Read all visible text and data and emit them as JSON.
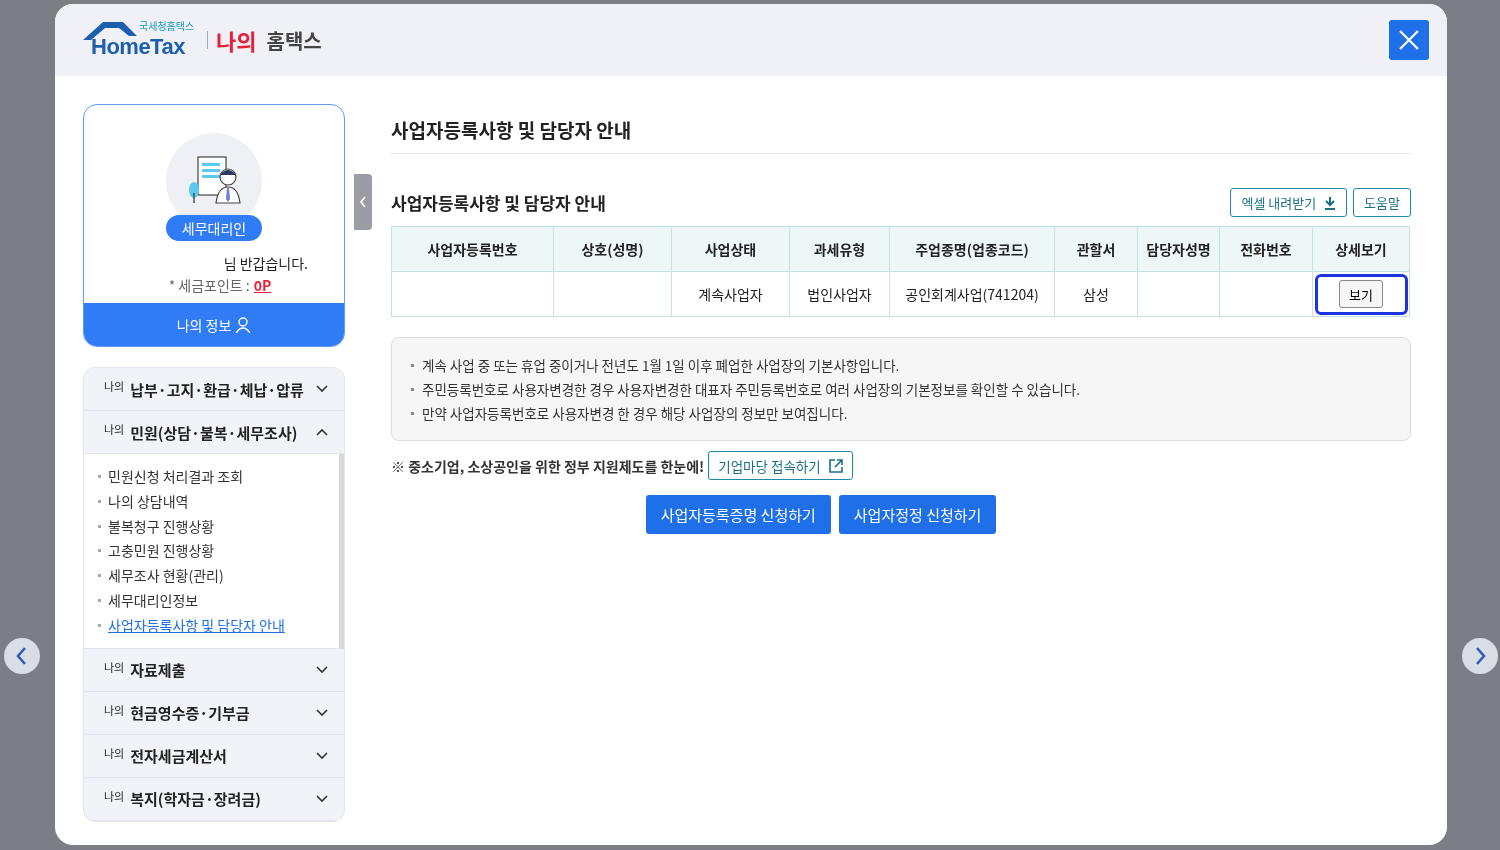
{
  "header": {
    "logo_subtitle": "국세청홈택스",
    "logo_text": "HomeTax",
    "title_highlight": "나의",
    "title": "홈택스"
  },
  "profile": {
    "badge": "세무대리인",
    "greeting": "님 반갑습니다.",
    "points_label": "* 세금포인트 :",
    "points_value": "0P",
    "my_info_button": "나의 정보"
  },
  "menu": [
    {
      "prefix": "나의",
      "label": "납부·고지·환급·체납·압류",
      "expanded": false
    },
    {
      "prefix": "나의",
      "label": "민원(상담·불복·세무조사)",
      "expanded": true,
      "children": [
        {
          "label": "민원신청 처리결과 조회",
          "selected": false
        },
        {
          "label": "나의 상담내역",
          "selected": false
        },
        {
          "label": "불복청구 진행상황",
          "selected": false
        },
        {
          "label": "고충민원 진행상황",
          "selected": false
        },
        {
          "label": "세무조사 현황(관리)",
          "selected": false
        },
        {
          "label": "세무대리인정보",
          "selected": false
        },
        {
          "label": "사업자등록사항 및 담당자 안내",
          "selected": true
        }
      ]
    },
    {
      "prefix": "나의",
      "label": "자료제출",
      "expanded": false
    },
    {
      "prefix": "나의",
      "label": "현금영수증·기부금",
      "expanded": false
    },
    {
      "prefix": "나의",
      "label": "전자세금계산서",
      "expanded": false
    },
    {
      "prefix": "나의",
      "label": "복지(학자금·장려금)",
      "expanded": false
    }
  ],
  "page_title": "사업자등록사항 및 담당자 안내",
  "section_title": "사업자등록사항 및 담당자 안내",
  "excel_button": "엑셀 내려받기",
  "help_button": "도움말",
  "table": {
    "columns": [
      "사업자등록번호",
      "상호(성명)",
      "사업상태",
      "과세유형",
      "주업종명(업종코드)",
      "관할서",
      "담당자성명",
      "전화번호",
      "상세보기"
    ],
    "rows": [
      {
        "cells": [
          "",
          "",
          "계속사업자",
          "법인사업자",
          "공인회계사업(741204)",
          "삼성",
          "",
          ""
        ],
        "detail_button": "보기",
        "highlighted": true
      }
    ]
  },
  "notes": [
    "계속 사업 중 또는 휴업 중이거나 전년도 1월 1일 이후 폐업한 사업장의 기본사항입니다.",
    "주민등록번호로 사용자변경한 경우 사용자변경한 대표자 주민등록번호로 여러 사업장의 기본정보를 확인할 수 있습니다.",
    "만약 사업자등록번호로 사용자변경 한 경우 해당 사업장의 정보만 보여집니다."
  ],
  "promo_text": "※ 중소기업, 소상공인을 위한 정부 지원제도를 한눈에!",
  "promo_link": "기업마당 접속하기",
  "actions": [
    "사업자등록증명 신청하기",
    "사업자정정 신청하기"
  ]
}
